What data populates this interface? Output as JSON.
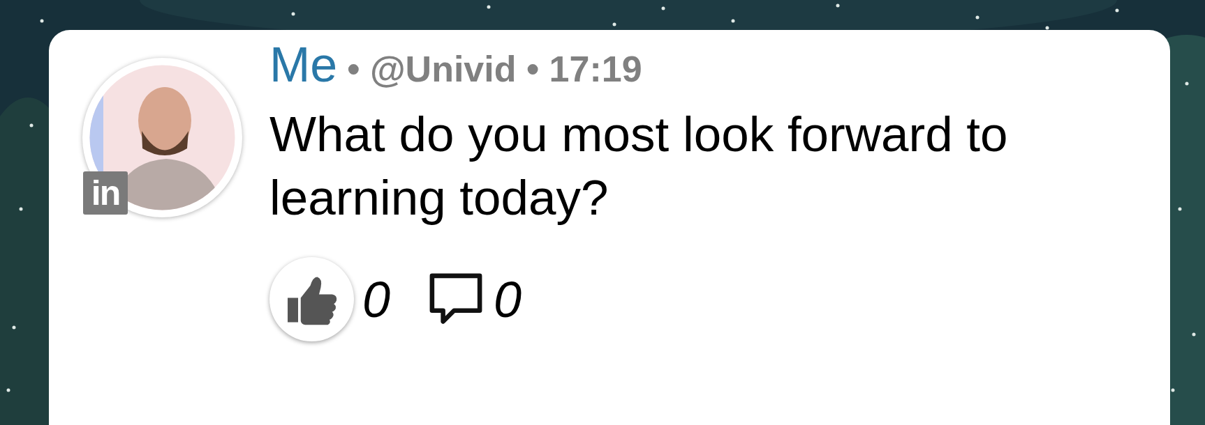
{
  "post": {
    "author": "Me",
    "meta": "• @Univid • 17:19",
    "badge": "in",
    "text": "What do you most look forward to learning today?",
    "likes": "0",
    "comments": "0"
  }
}
